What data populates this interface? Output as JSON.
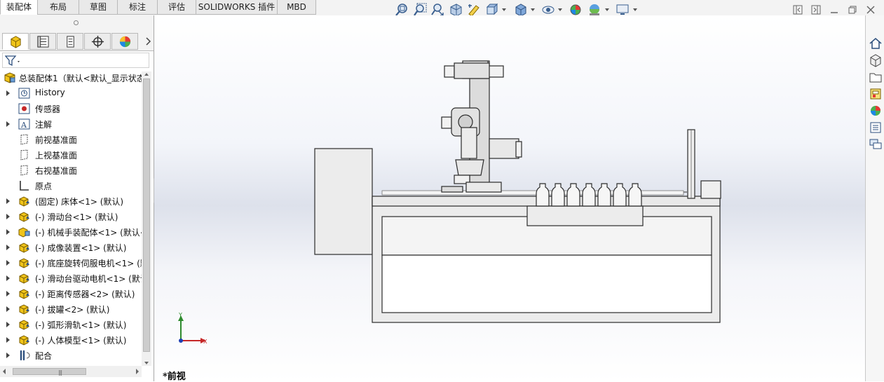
{
  "tabs": [
    {
      "label": "装配体",
      "active": true
    },
    {
      "label": "布局",
      "active": false
    },
    {
      "label": "草图",
      "active": false
    },
    {
      "label": "标注",
      "active": false
    },
    {
      "label": "评估",
      "active": false
    },
    {
      "label": "SOLIDWORKS 插件",
      "active": false
    },
    {
      "label": "MBD",
      "active": false
    }
  ],
  "heads_up_toolbar": {
    "icons": [
      "zoom-to-fit-icon",
      "zoom-to-area-icon",
      "previous-view-icon",
      "section-view-icon",
      "dynamic-annotation-icon",
      "view-orientation-icon",
      "display-style-icon",
      "hide-show-items-icon",
      "edit-appearance-icon",
      "apply-scene-icon",
      "view-settings-icon"
    ]
  },
  "manager_tabs": [
    "featuremanager-icon",
    "propertymanager-icon",
    "configurationmanager-icon",
    "dimxpertmanager-icon",
    "displaymanager-icon"
  ],
  "feature_tree": {
    "root": "总装配体1（默认<默认_显示状态",
    "items": [
      {
        "label": "History",
        "icon": "history-icon",
        "expandable": true
      },
      {
        "label": "传感器",
        "icon": "sensor-icon",
        "expandable": false
      },
      {
        "label": "注解",
        "icon": "annotation-icon",
        "expandable": true
      },
      {
        "label": "前视基准面",
        "icon": "plane-icon",
        "expandable": false
      },
      {
        "label": "上视基准面",
        "icon": "plane-icon",
        "expandable": false
      },
      {
        "label": "右视基准面",
        "icon": "plane-icon",
        "expandable": false
      },
      {
        "label": "原点",
        "icon": "origin-icon",
        "expandable": false
      },
      {
        "label": "(固定) 床体<1> (默认)",
        "icon": "part-icon",
        "expandable": true
      },
      {
        "label": "(-) 滑动台<1> (默认)",
        "icon": "part-icon",
        "expandable": true
      },
      {
        "label": "(-) 机械手装配体<1> (默认<",
        "icon": "subassembly-icon",
        "expandable": true
      },
      {
        "label": "(-) 成像装置<1> (默认)",
        "icon": "part-icon",
        "expandable": true
      },
      {
        "label": "(-) 底座旋转伺服电机<1> (默",
        "icon": "part-icon",
        "expandable": true
      },
      {
        "label": "(-) 滑动台驱动电机<1> (默认",
        "icon": "part-icon",
        "expandable": true
      },
      {
        "label": "(-) 距离传感器<2> (默认)",
        "icon": "part-icon",
        "expandable": true
      },
      {
        "label": "(-) 拔罐<2> (默认)",
        "icon": "part-icon",
        "expandable": true
      },
      {
        "label": "(-) 弧形滑轨<1> (默认)",
        "icon": "part-icon",
        "expandable": true
      },
      {
        "label": "(-) 人体模型<1> (默认)",
        "icon": "part-icon",
        "expandable": true
      },
      {
        "label": "配合",
        "icon": "mates-icon",
        "expandable": true
      }
    ]
  },
  "viewport": {
    "view_name": "*前视",
    "triad": {
      "y_label": "Y",
      "x_label": "X"
    }
  },
  "task_pane": [
    "home-icon",
    "design-library-icon",
    "file-explorer-icon",
    "view-palette-icon",
    "appearances-icon",
    "custom-properties-icon",
    "forum-icon"
  ],
  "colors": {
    "accent": "#1e5fb4",
    "yellow_part": "#e8c21a",
    "tab_bg": "#e9e9e9"
  }
}
